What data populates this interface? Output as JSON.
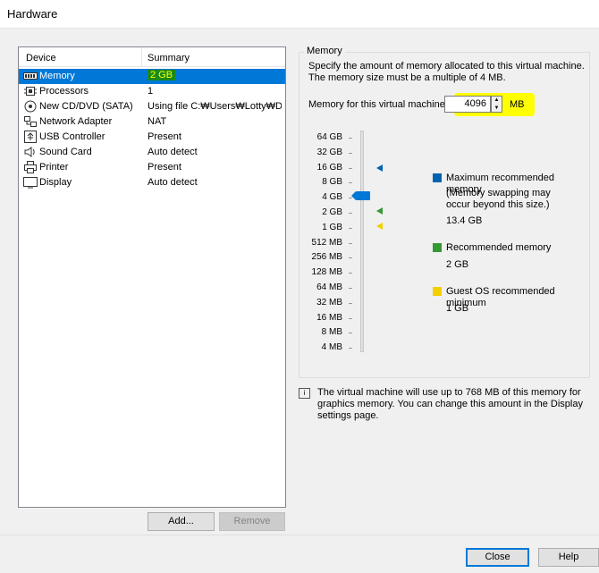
{
  "window": {
    "title": "Hardware"
  },
  "device_list": {
    "headers": {
      "device": "Device",
      "summary": "Summary"
    },
    "rows": [
      {
        "name": "Memory",
        "summary": "2 GB",
        "icon": "memory-icon",
        "selected": true
      },
      {
        "name": "Processors",
        "summary": "1",
        "icon": "processor-icon"
      },
      {
        "name": "New CD/DVD (SATA)",
        "summary": "Using file C:₩Users₩Lotty₩D...",
        "icon": "cd-dvd-icon"
      },
      {
        "name": "Network Adapter",
        "summary": "NAT",
        "icon": "network-icon"
      },
      {
        "name": "USB Controller",
        "summary": "Present",
        "icon": "usb-icon"
      },
      {
        "name": "Sound Card",
        "summary": "Auto detect",
        "icon": "speaker-icon"
      },
      {
        "name": "Printer",
        "summary": "Present",
        "icon": "printer-icon"
      },
      {
        "name": "Display",
        "summary": "Auto detect",
        "icon": "monitor-icon"
      }
    ],
    "add_label": "Add...",
    "remove_label": "Remove"
  },
  "memory": {
    "group_label": "Memory",
    "description": "Specify the amount of memory allocated to this virtual machine. The memory size must be a multiple of 4 MB.",
    "field_label": "Memory for this virtual machine:",
    "value": "4096",
    "unit": "MB",
    "scale_labels": [
      "64 GB",
      "32 GB",
      "16 GB",
      "8 GB",
      "4 GB",
      "2 GB",
      "1 GB",
      "512 MB",
      "256 MB",
      "128 MB",
      "64 MB",
      "32 MB",
      "16 MB",
      "8 MB",
      "4 MB"
    ],
    "legend": {
      "max_title": "Maximum recommended memory",
      "max_note": "(Memory swapping may occur beyond this size.)",
      "max_value": "13.4 GB",
      "rec_title": "Recommended memory",
      "rec_value": "2 GB",
      "min_title": "Guest OS recommended minimum",
      "min_value": "1 GB"
    },
    "colors": {
      "max": "#0063b1",
      "recommended": "#339933",
      "minimum": "#f2d000"
    },
    "info_text": "The virtual machine will use up to 768 MB of this memory for graphics memory. You can change this amount in the Display settings page."
  },
  "footer": {
    "close_label": "Close",
    "help_label": "Help"
  }
}
